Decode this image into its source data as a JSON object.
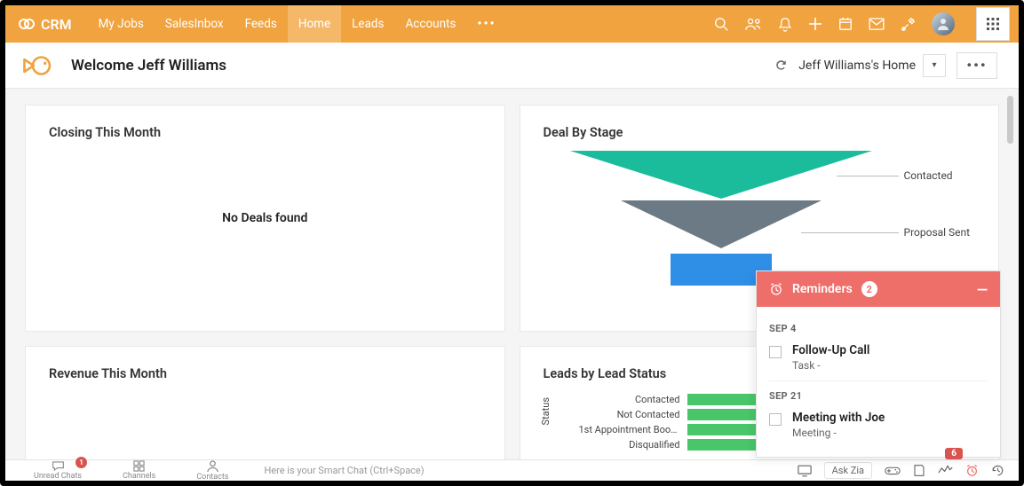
{
  "brand": "CRM",
  "nav": {
    "items": [
      "My Jobs",
      "SalesInbox",
      "Feeds",
      "Home",
      "Leads",
      "Accounts"
    ],
    "active_index": 3
  },
  "subheader": {
    "welcome": "Welcome Jeff Williams",
    "home_label": "Jeff Williams's Home"
  },
  "cards": {
    "closing": {
      "title": "Closing This Month",
      "empty": "No Deals found"
    },
    "dealstage": {
      "title": "Deal By Stage"
    },
    "revenue": {
      "title": "Revenue This Month"
    },
    "leads": {
      "title": "Leads by Lead Status",
      "axis": "Status"
    }
  },
  "chart_data": [
    {
      "type": "funnel",
      "title": "Deal By Stage",
      "stages": [
        {
          "name": "Contacted",
          "color": "#1abc9c"
        },
        {
          "name": "Proposal Sent",
          "color": "#6c7a85"
        },
        {
          "name": "",
          "color": "#2f8fe6"
        }
      ]
    },
    {
      "type": "bar",
      "orientation": "horizontal",
      "title": "Leads by Lead Status",
      "ylabel": "Status",
      "categories": [
        "Contacted",
        "Not Contacted",
        "1st Appointment Book...",
        "Disqualified"
      ],
      "values": [
        1,
        2,
        1,
        1
      ],
      "xlim": [
        0,
        2
      ],
      "color": "#49c66a"
    }
  ],
  "reminders": {
    "title": "Reminders",
    "count": 2,
    "badge": 6,
    "groups": [
      {
        "date": "SEP 4",
        "items": [
          {
            "title": "Follow-Up Call",
            "sub": "Task -"
          }
        ]
      },
      {
        "date": "SEP 21",
        "items": [
          {
            "title": "Meeting with Joe",
            "sub": "Meeting -"
          }
        ]
      }
    ]
  },
  "bottombar": {
    "tabs": [
      {
        "label": "Unread Chats",
        "icon": "chat",
        "badge": 1
      },
      {
        "label": "Channels",
        "icon": "grid"
      },
      {
        "label": "Contacts",
        "icon": "person"
      }
    ],
    "smartchat": "Here is your Smart Chat (Ctrl+Space)",
    "askzia": "Ask Zia"
  }
}
